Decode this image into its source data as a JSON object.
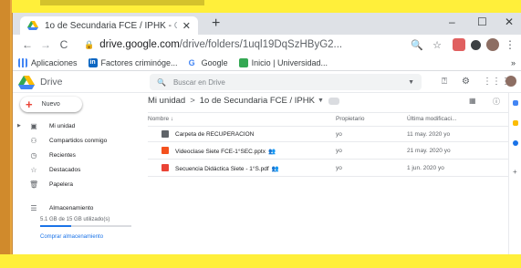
{
  "browser": {
    "tab_title": "1o de Secundaria FCE / IPHK -",
    "tab_title_fade": "G",
    "tab_close": "✕",
    "new_tab": "+",
    "minimize": "–",
    "maximize": "☐",
    "close": "✕",
    "back": "←",
    "forward": "→",
    "reload": "C",
    "url_host": "drive.google.com",
    "url_path": "/drive/folders/1uql19DqSzHByG2...",
    "bookmarks": [
      {
        "label": "Aplicaciones",
        "icon": "apps-grid-icon",
        "color": "#1a73e8"
      },
      {
        "label": "Factores criminóge...",
        "icon": "linkedin-icon",
        "color": "#0a66c2"
      },
      {
        "label": "Google",
        "icon": "google-icon",
        "color": "#4285f4"
      },
      {
        "label": "Inicio | Universidad...",
        "icon": "university-icon",
        "color": "#34a853"
      }
    ],
    "more_bookmarks": "»"
  },
  "drive": {
    "app_name": "Drive",
    "search_placeholder": "Buscar en Drive",
    "new_button": "Nuevo",
    "nav": [
      {
        "label": "Mi unidad",
        "icon": "my-drive-icon",
        "glyph": "▣"
      },
      {
        "label": "Compartidos conmigo",
        "icon": "shared-with-me-icon",
        "glyph": "👥"
      },
      {
        "label": "Recientes",
        "icon": "recent-clock-icon",
        "glyph": "◷"
      },
      {
        "label": "Destacados",
        "icon": "star-icon",
        "glyph": "☆"
      },
      {
        "label": "Papelera",
        "icon": "trash-icon",
        "glyph": "🗑"
      }
    ],
    "storage_label": "Almacenamiento",
    "storage_used": "5.1 GB de 15 GB utilizado(s)",
    "storage_fraction": 0.34,
    "buy_storage": "Comprar almacenamiento",
    "breadcrumb_root": "Mi unidad",
    "breadcrumb_sep": ">",
    "breadcrumb_current": "1o de Secundaria FCE / IPHK",
    "columns": {
      "name": "Nombre ↓",
      "owner": "Propietario",
      "modified": "Última modificaci..."
    },
    "files": [
      {
        "name": "Carpeta de RECUPERACION",
        "shared": "",
        "owner": "yo",
        "modified": "11 may. 2020 yo",
        "icon": "folder-icon",
        "color": "#5f6368"
      },
      {
        "name": "Videoclase Siete FCE-1°SEC.pptx",
        "shared": "👥",
        "owner": "yo",
        "modified": "21 may. 2020 yo",
        "icon": "slides-file-icon",
        "color": "#f4511e"
      },
      {
        "name": "Secuencia Didáctica Siete - 1°S.pdf",
        "shared": "👥",
        "owner": "yo",
        "modified": "1 jun. 2020 yo",
        "icon": "pdf-file-icon",
        "color": "#ea4335"
      }
    ]
  }
}
